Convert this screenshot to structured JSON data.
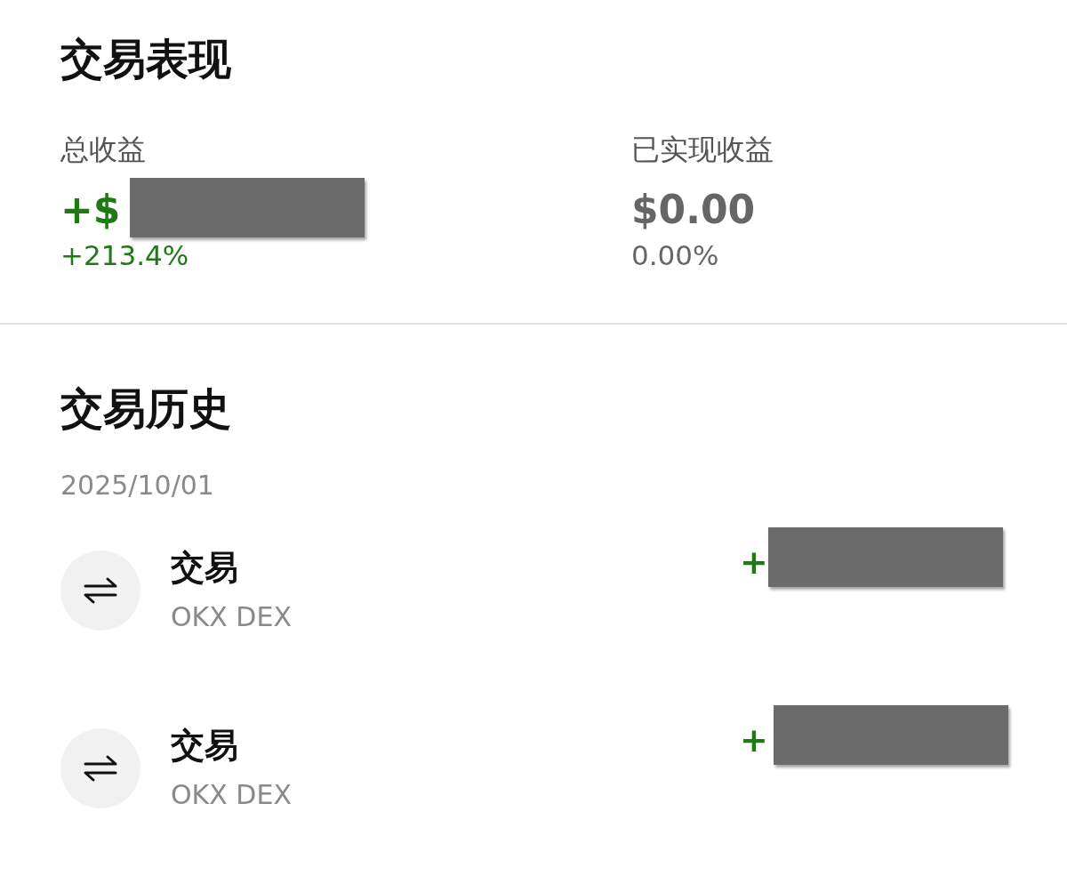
{
  "performance": {
    "title": "交易表现",
    "stats": [
      {
        "label": "总收益",
        "value": "+$",
        "change": "+213.4%",
        "color": "#1e7a12",
        "redacted": true
      },
      {
        "label": "已实现收益",
        "value": "$0.00",
        "change": "0.00%",
        "color": "#666666",
        "redacted": false
      }
    ]
  },
  "history": {
    "title": "交易历史",
    "date": "2025/10/01",
    "rows": [
      {
        "title": "交易",
        "subtitle": "OKX DEX",
        "amount": "+",
        "redacted": true
      },
      {
        "title": "交易",
        "subtitle": "OKX DEX",
        "amount": "+",
        "redacted": true
      }
    ]
  }
}
